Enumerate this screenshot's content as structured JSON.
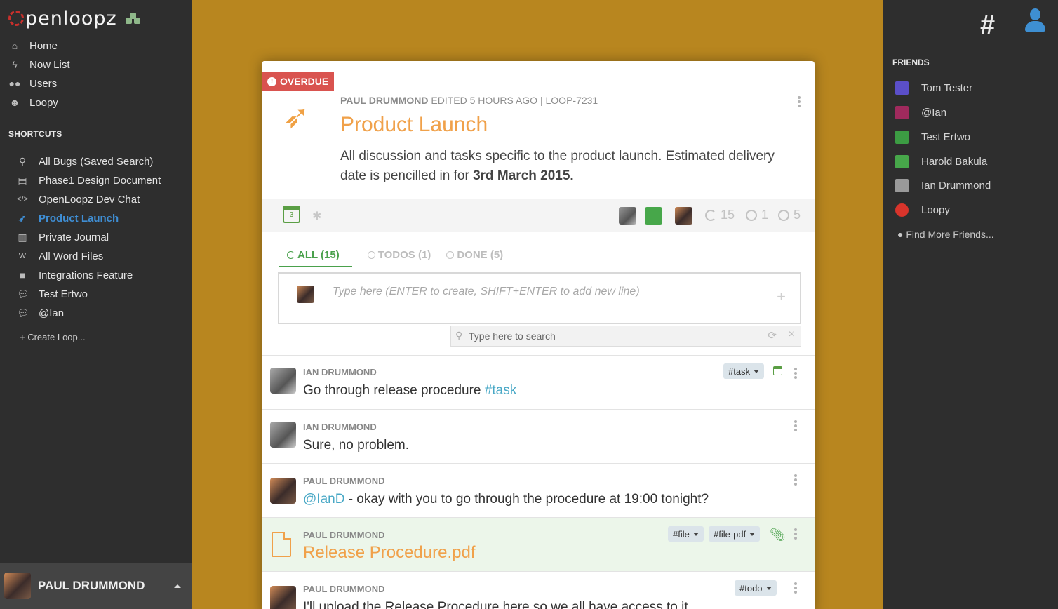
{
  "app": {
    "logo_text": "penloopz"
  },
  "nav": [
    {
      "label": "Home",
      "icon": "home-icon"
    },
    {
      "label": "Now List",
      "icon": "bolt-icon"
    },
    {
      "label": "Users",
      "icon": "users-icon"
    },
    {
      "label": "Loopy",
      "icon": "loopy-icon"
    }
  ],
  "shortcuts": {
    "title": "SHORTCUTS",
    "items": [
      {
        "label": "All Bugs (Saved Search)",
        "icon": "search-icon"
      },
      {
        "label": "Phase1 Design Document",
        "icon": "document-icon"
      },
      {
        "label": "OpenLoopz Dev Chat",
        "icon": "code-icon"
      },
      {
        "label": "Product Launch",
        "icon": "rocket-icon",
        "active": true
      },
      {
        "label": "Private Journal",
        "icon": "book-icon"
      },
      {
        "label": "All Word Files",
        "icon": "word-file-icon"
      },
      {
        "label": "Integrations Feature",
        "icon": "square-icon"
      },
      {
        "label": "Test Ertwo",
        "icon": "chat-icon"
      },
      {
        "label": "@Ian",
        "icon": "chat-icon"
      }
    ],
    "create": "Create Loop..."
  },
  "current_user": {
    "name": "PAUL DRUMMOND"
  },
  "friends": {
    "title": "FRIENDS",
    "items": [
      {
        "name": "Tom Tester",
        "color": "#5b4fc9"
      },
      {
        "name": "@Ian",
        "color": "#a02a5d"
      },
      {
        "name": "Test Ertwo",
        "color": "#3c9c43"
      },
      {
        "name": "Harold Bakula",
        "color": "#47a74a"
      },
      {
        "name": "Ian Drummond",
        "color": "#9a9a9a"
      },
      {
        "name": "Loopy",
        "color": "#d9342b"
      }
    ],
    "find_more": "Find More Friends..."
  },
  "loop": {
    "status": "OVERDUE",
    "author": "PAUL DRUMMOND",
    "edited": "EDITED 5 HOURS AGO",
    "separator": "|",
    "id": "LOOP-7231",
    "title": "Product Launch",
    "description": "All discussion and tasks specific to the product launch. Estimated delivery date is pencilled in for ",
    "description_bold": "3rd March 2015.",
    "calendar_day": "3",
    "stats": {
      "all": "15",
      "todos": "1",
      "done": "5"
    }
  },
  "tabs": [
    {
      "label": "ALL (15)",
      "active": true
    },
    {
      "label": "TODOS (1)"
    },
    {
      "label": "DONE (5)"
    }
  ],
  "compose": {
    "placeholder": "Type here (ENTER to create, SHIFT+ENTER to add new line)"
  },
  "search": {
    "placeholder": "Type here to search"
  },
  "messages": [
    {
      "author": "IAN DRUMMOND",
      "text": "Go through release procedure ",
      "tag": "#task",
      "badges": [
        "#task"
      ]
    },
    {
      "author": "IAN DRUMMOND",
      "text": "Sure, no problem."
    },
    {
      "author": "PAUL DRUMMOND",
      "mention": "@IanD",
      "text": " - okay with you to go through the procedure at 19:00 tonight?"
    },
    {
      "author": "PAUL DRUMMOND",
      "text": "Release Procedure.pdf",
      "badges": [
        "#file",
        "#file-pdf"
      ]
    },
    {
      "author": "PAUL DRUMMOND",
      "text": "I'll upload the Release Procedure here so we all have access to it.",
      "badges": [
        "#todo"
      ]
    }
  ]
}
